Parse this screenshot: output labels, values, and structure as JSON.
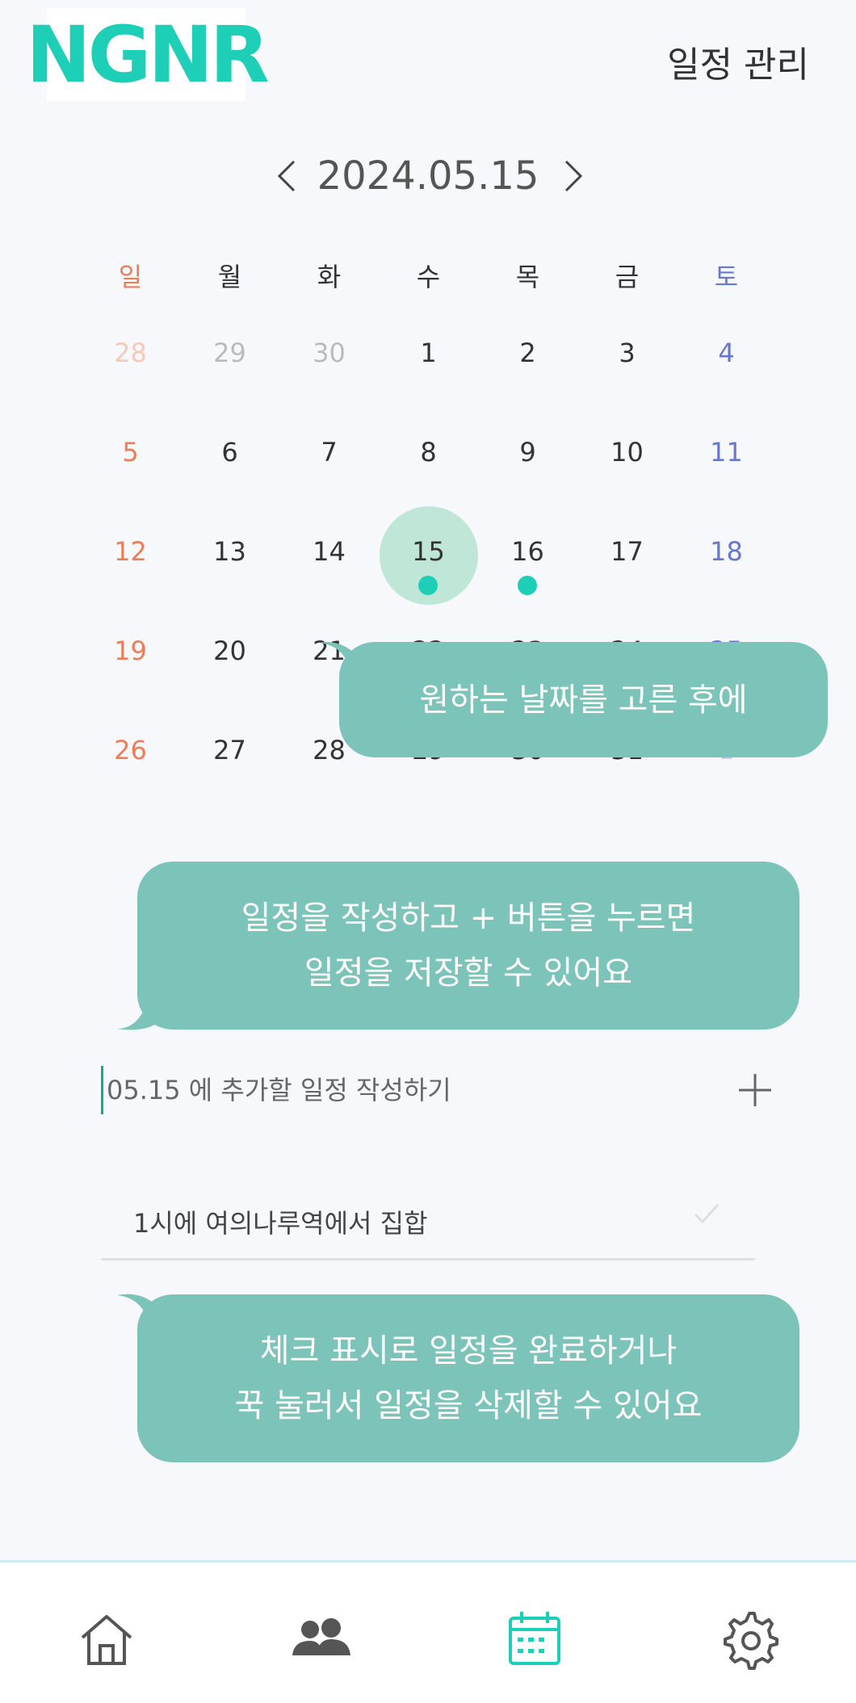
{
  "header": {
    "logo_text": "NGNR",
    "title": "일정 관리"
  },
  "calendar": {
    "date_label": "2024.05.15",
    "weekdays": [
      "일",
      "월",
      "화",
      "수",
      "목",
      "금",
      "토"
    ],
    "weeks": [
      [
        "28",
        "29",
        "30",
        "1",
        "2",
        "3",
        "4"
      ],
      [
        "5",
        "6",
        "7",
        "8",
        "9",
        "10",
        "11"
      ],
      [
        "12",
        "13",
        "14",
        "15",
        "16",
        "17",
        "18"
      ],
      [
        "19",
        "20",
        "21",
        "22",
        "23",
        "24",
        "25"
      ],
      [
        "26",
        "27",
        "28",
        "29",
        "30",
        "31",
        "1"
      ]
    ],
    "selected": "15",
    "event_days": [
      "15",
      "16"
    ]
  },
  "tips": {
    "tip1": "원하는 날짜를 고른 후에",
    "tip2_line1": "일정을 작성하고 + 버튼을 누르면",
    "tip2_line2": "일정을 저장할 수 있어요",
    "tip3_line1": "체크 표시로 일정을 완료하거나",
    "tip3_line2": "꾹 눌러서 일정을 삭제할 수 있어요"
  },
  "schedule_input": {
    "placeholder": "05.15 에 추가할 일정 작성하기",
    "value": ""
  },
  "todos": [
    {
      "text": "1시에 여의나루역에서 집합",
      "done": false
    }
  ],
  "tabbar": {
    "icons": [
      "home-icon",
      "friends-icon",
      "calendar-icon",
      "settings-icon"
    ],
    "active": "calendar-icon"
  },
  "colors": {
    "accent": "#1ecfb8",
    "bubble": "#7cc3b9",
    "selected": "#bfe6d6",
    "sunday": "#ee7d57",
    "saturday": "#6677cc"
  }
}
